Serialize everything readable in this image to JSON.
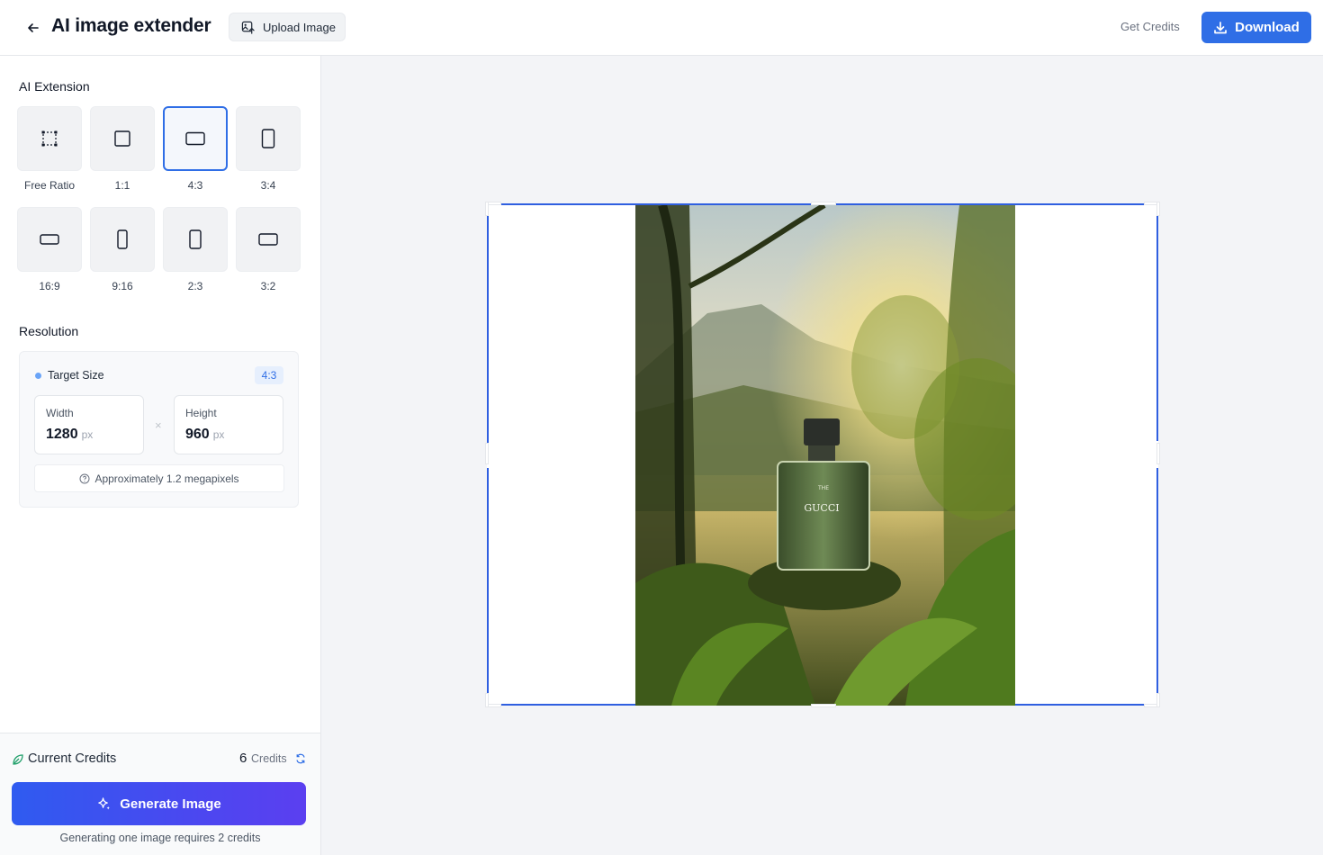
{
  "header": {
    "title": "AI image extender",
    "upload_label": "Upload Image",
    "get_credits_label": "Get Credits",
    "download_label": "Download"
  },
  "sidebar": {
    "extension_title": "AI Extension",
    "ratios": [
      {
        "label": "Free Ratio",
        "icon": "free-ratio-icon",
        "selected": false
      },
      {
        "label": "1:1",
        "icon": "square-icon",
        "selected": false
      },
      {
        "label": "4:3",
        "icon": "landscape-rect-icon",
        "selected": true
      },
      {
        "label": "3:4",
        "icon": "portrait-rect-icon",
        "selected": false
      },
      {
        "label": "16:9",
        "icon": "wide-rect-icon",
        "selected": false
      },
      {
        "label": "9:16",
        "icon": "tall-rect-icon",
        "selected": false
      },
      {
        "label": "2:3",
        "icon": "portrait-rect-icon",
        "selected": false
      },
      {
        "label": "3:2",
        "icon": "landscape-rect-icon",
        "selected": false
      }
    ],
    "resolution_title": "Resolution",
    "resolution": {
      "target_label": "Target Size",
      "ratio_badge": "4:3",
      "width_label": "Width",
      "width_value": "1280",
      "height_label": "Height",
      "height_value": "960",
      "unit": "px",
      "times": "×",
      "megapixels_note": "Approximately 1.2 megapixels"
    }
  },
  "footer": {
    "credits_label": "Current Credits",
    "credits_count": "6",
    "credits_word": "Credits",
    "generate_label": "Generate Image",
    "generate_note": "Generating one image requires 2 credits"
  },
  "canvas": {
    "product_text": "GUCCI",
    "product_subtext": "THE",
    "colors": {
      "accent": "#2f6ee6",
      "frame": "#2f5fe0"
    }
  }
}
